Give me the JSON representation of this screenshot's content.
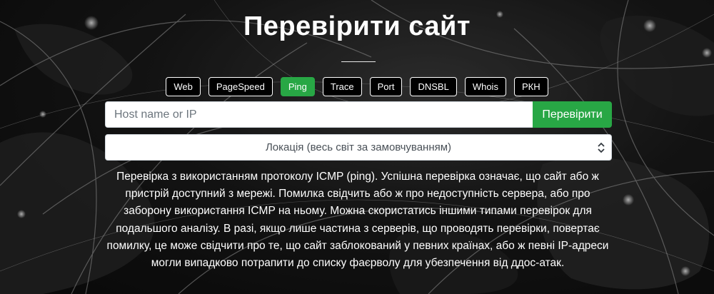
{
  "page": {
    "title": "Перевірити сайт"
  },
  "tabs": [
    {
      "label": "Web",
      "active": false
    },
    {
      "label": "PageSpeed",
      "active": false
    },
    {
      "label": "Ping",
      "active": true
    },
    {
      "label": "Trace",
      "active": false
    },
    {
      "label": "Port",
      "active": false
    },
    {
      "label": "DNSBL",
      "active": false
    },
    {
      "label": "Whois",
      "active": false
    },
    {
      "label": "РКН",
      "active": false
    }
  ],
  "search": {
    "placeholder": "Host name or IP",
    "value": "",
    "button_label": "Перевірити"
  },
  "location": {
    "selected": "Локація (весь світ за замовчуванням)"
  },
  "description": "Перевірка з використанням протоколу ICMP (ping). Успішна перевірка означає, що сайт або ж пристрій доступний з мережі. Помилка свідчить або ж про недоступність сервера, або про заборону використання ICMP на ньому. Можна скористатись іншими типами перевірок для подальшого аналізу. В разі, якщо лише частина з серверів, що проводять перевірки, повертає помилку, це може свідчити про те, що сайт заблокований у певних країнах, або ж певні IP-адреси могли випадково потрапити до списку фаєрволу для убезпечення від ддос-атак.",
  "colors": {
    "accent": "#28a745",
    "background": "#111111",
    "text": "#ffffff"
  }
}
